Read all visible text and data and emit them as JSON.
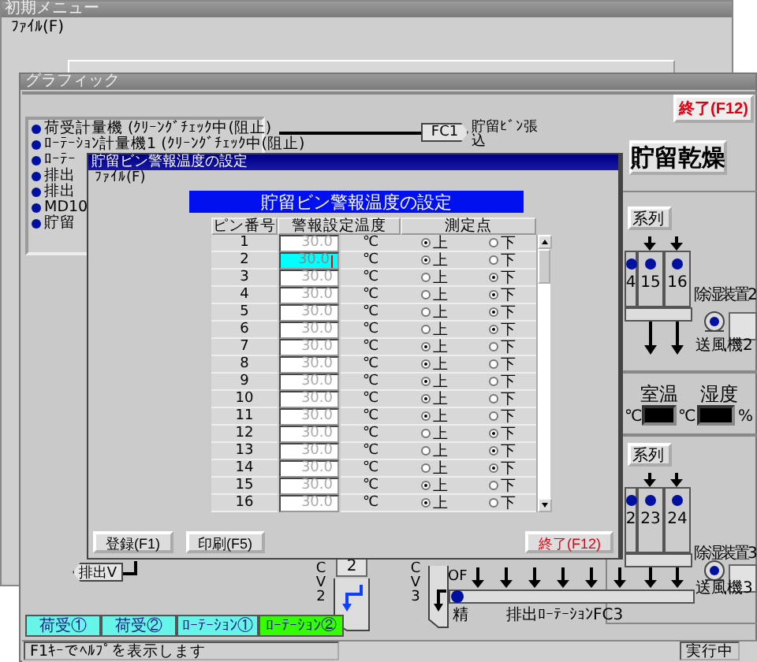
{
  "back_window": {
    "title": "初期メニュー",
    "menu": [
      "ﾌｧｲﾙ(F)"
    ]
  },
  "graphic_window": {
    "title": "グラフィック",
    "exit_button": "終了(F12)",
    "legend": [
      "荷受計量機 (ｸﾘｰﾝｸﾞﾁｪｯｸ中(阻止)",
      "ﾛｰﾃｰｼｮﾝ計量機1 (ｸﾘｰﾝｸﾞﾁｪｯｸ中(阻止)",
      "ﾛｰﾃｰ",
      "排出",
      "排出",
      "MD10",
      "貯留"
    ],
    "diagram": {
      "fc1_tag": "FC1",
      "fc1_label": "貯留ﾋﾞﾝ張込",
      "title": "貯留乾燥",
      "lines": [
        {
          "label": "系列",
          "bins": [
            "4",
            "15",
            "16"
          ],
          "dehumidifier": "除湿装置2",
          "fan": "送風機2"
        },
        {
          "label": "系列",
          "bins": [
            "2",
            "23",
            "24"
          ],
          "dehumidifier": "除湿装置3",
          "fan": "送風機3"
        }
      ],
      "room_temp_label": "室温",
      "humidity_label": "湿度",
      "units": [
        "℃",
        "℃",
        "%"
      ],
      "conveyor": {
        "gate": "OF",
        "outlet": "精",
        "label": "排出ﾛｰﾃｰｼｮﾝFC3"
      },
      "cv": [
        "CV2",
        "CV3"
      ],
      "cv_box": "2",
      "discharge_tag": "排出V"
    },
    "line_buttons": [
      {
        "label": "荷受①",
        "selected": false
      },
      {
        "label": "荷受②",
        "selected": false
      },
      {
        "label": "ﾛｰﾃｰｼｮﾝ①",
        "selected": false
      },
      {
        "label": "ﾛｰﾃｰｼｮﾝ②",
        "selected": true
      }
    ],
    "status": "F1ｷｰでﾍﾙﾌﾟを表示します",
    "state": "実行中"
  },
  "dialog": {
    "title": "貯留ビン警報温度の設定",
    "menu": [
      "ﾌｧｲﾙ(F)"
    ],
    "heading": "貯留ビン警報温度の設定",
    "columns": [
      "ピン番号",
      "警報設定温度",
      "測定点"
    ],
    "rows": [
      {
        "number": "1",
        "temperature": "30.0",
        "unit": "℃",
        "focused": false,
        "options": [
          {
            "label": "上",
            "selected": true
          },
          {
            "label": "下",
            "selected": false
          }
        ]
      },
      {
        "number": "2",
        "temperature": "30.0",
        "unit": "℃",
        "focused": true,
        "options": [
          {
            "label": "上",
            "selected": true
          },
          {
            "label": "下",
            "selected": false
          }
        ]
      },
      {
        "number": "3",
        "temperature": "30.0",
        "unit": "℃",
        "focused": false,
        "options": [
          {
            "label": "上",
            "selected": false
          },
          {
            "label": "下",
            "selected": true
          }
        ]
      },
      {
        "number": "4",
        "temperature": "30.0",
        "unit": "℃",
        "focused": false,
        "options": [
          {
            "label": "上",
            "selected": false
          },
          {
            "label": "下",
            "selected": true
          }
        ]
      },
      {
        "number": "5",
        "temperature": "30.0",
        "unit": "℃",
        "focused": false,
        "options": [
          {
            "label": "上",
            "selected": false
          },
          {
            "label": "下",
            "selected": true
          }
        ]
      },
      {
        "number": "6",
        "temperature": "30.0",
        "unit": "℃",
        "focused": false,
        "options": [
          {
            "label": "上",
            "selected": false
          },
          {
            "label": "下",
            "selected": true
          }
        ]
      },
      {
        "number": "7",
        "temperature": "30.0",
        "unit": "℃",
        "focused": false,
        "options": [
          {
            "label": "上",
            "selected": true
          },
          {
            "label": "下",
            "selected": false
          }
        ]
      },
      {
        "number": "8",
        "temperature": "30.0",
        "unit": "℃",
        "focused": false,
        "options": [
          {
            "label": "上",
            "selected": true
          },
          {
            "label": "下",
            "selected": false
          }
        ]
      },
      {
        "number": "9",
        "temperature": "30.0",
        "unit": "℃",
        "focused": false,
        "options": [
          {
            "label": "上",
            "selected": true
          },
          {
            "label": "下",
            "selected": false
          }
        ]
      },
      {
        "number": "10",
        "temperature": "30.0",
        "unit": "℃",
        "focused": false,
        "options": [
          {
            "label": "上",
            "selected": true
          },
          {
            "label": "下",
            "selected": false
          }
        ]
      },
      {
        "number": "11",
        "temperature": "30.0",
        "unit": "℃",
        "focused": false,
        "options": [
          {
            "label": "上",
            "selected": true
          },
          {
            "label": "下",
            "selected": false
          }
        ]
      },
      {
        "number": "12",
        "temperature": "30.0",
        "unit": "℃",
        "focused": false,
        "options": [
          {
            "label": "上",
            "selected": false
          },
          {
            "label": "下",
            "selected": true
          }
        ]
      },
      {
        "number": "13",
        "temperature": "30.0",
        "unit": "℃",
        "focused": false,
        "options": [
          {
            "label": "上",
            "selected": false
          },
          {
            "label": "下",
            "selected": true
          }
        ]
      },
      {
        "number": "14",
        "temperature": "30.0",
        "unit": "℃",
        "focused": false,
        "options": [
          {
            "label": "上",
            "selected": false
          },
          {
            "label": "下",
            "selected": true
          }
        ]
      },
      {
        "number": "15",
        "temperature": "30.0",
        "unit": "℃",
        "focused": false,
        "options": [
          {
            "label": "上",
            "selected": true
          },
          {
            "label": "下",
            "selected": false
          }
        ]
      },
      {
        "number": "16",
        "temperature": "30.0",
        "unit": "℃",
        "focused": false,
        "options": [
          {
            "label": "上",
            "selected": true
          },
          {
            "label": "下",
            "selected": false
          }
        ]
      }
    ],
    "buttons": [
      "登録(F1)",
      "印刷(F5)"
    ],
    "exit_button": "終了(F12)"
  }
}
